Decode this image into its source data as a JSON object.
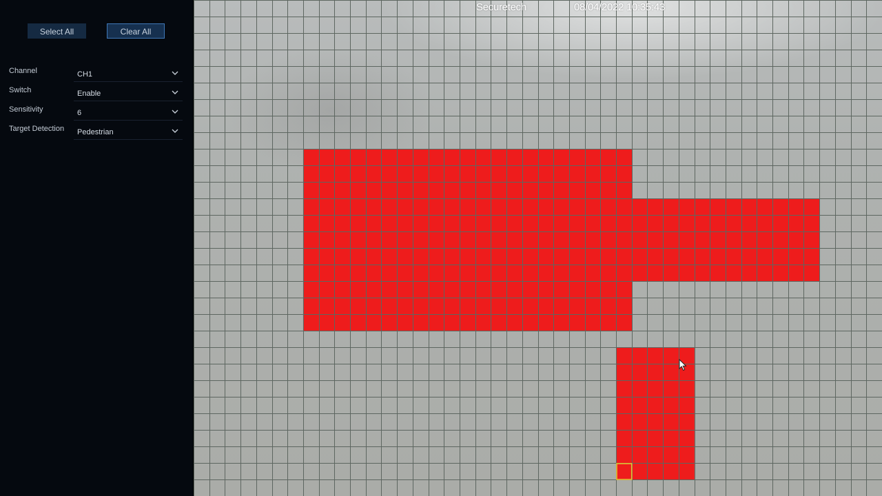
{
  "toolbar": {
    "select_all_label": "Select All",
    "clear_all_label": "Clear All"
  },
  "settings": [
    {
      "label": "Channel",
      "value": "CH1"
    },
    {
      "label": "Switch",
      "value": "Enable"
    },
    {
      "label": "Sensitivity",
      "value": "6"
    },
    {
      "label": "Target Detection",
      "value": "Pedestrian"
    }
  ],
  "video": {
    "osd_name": "Securetech",
    "osd_datetime": "08/04/2022 10:35:43"
  },
  "detection_grid": {
    "columns": 44,
    "rows": 30,
    "selected_color": "#ee1c1c",
    "grid_line_color": "#5d6660",
    "focus_cell_color": "#e8c233",
    "selected_blocks": [
      {
        "col_start": 7,
        "col_end": 27,
        "row_start": 9,
        "row_end": 19
      },
      {
        "col_start": 28,
        "col_end": 39,
        "row_start": 12,
        "row_end": 16
      },
      {
        "col_start": 27,
        "col_end": 31,
        "row_start": 21,
        "row_end": 28
      }
    ],
    "focus_cell": {
      "col": 27,
      "row": 28
    }
  },
  "icons": {
    "dropdown": "chevron-down-icon",
    "pointer": "mouse-cursor-icon"
  }
}
